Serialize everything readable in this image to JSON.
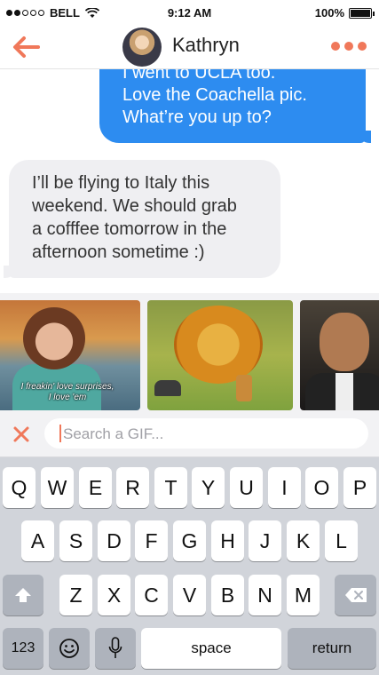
{
  "status_bar": {
    "carrier": "BELL",
    "time": "9:12 AM",
    "battery": "100%",
    "signal_bars_filled": 2,
    "signal_bars_total": 5
  },
  "header": {
    "contact_name": "Kathryn",
    "accent_color": "#f0785a"
  },
  "messages": {
    "outgoing": {
      "lines": [
        "I went to UCLA too.",
        "Love the Coachella pic.",
        "What’re you up to?"
      ],
      "color": "#2d8cf0"
    },
    "incoming": {
      "lines": [
        "I’ll be flying to Italy this",
        "weekend. We should grab",
        "a cofffee tomorrow in the",
        "afternoon sometime :)"
      ],
      "color": "#efeff2"
    }
  },
  "gifs": {
    "gif1_caption_line1": "I freakin' love surprises,",
    "gif1_caption_line2": "I love 'em"
  },
  "search": {
    "placeholder": "Search a GIF..."
  },
  "keyboard": {
    "row1": [
      "Q",
      "W",
      "E",
      "R",
      "T",
      "Y",
      "U",
      "I",
      "O",
      "P"
    ],
    "row2": [
      "A",
      "S",
      "D",
      "F",
      "G",
      "H",
      "J",
      "K",
      "L"
    ],
    "row3": [
      "Z",
      "X",
      "C",
      "V",
      "B",
      "N",
      "M"
    ],
    "numbers_label": "123",
    "space_label": "space",
    "return_label": "return"
  }
}
